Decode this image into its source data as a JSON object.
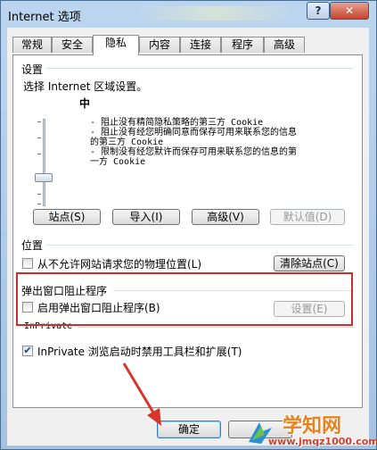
{
  "window": {
    "title": "Internet 选项",
    "help_label": "?",
    "close_label": "✕"
  },
  "tabs": [
    {
      "label": "常规"
    },
    {
      "label": "安全"
    },
    {
      "label": "隐私"
    },
    {
      "label": "内容"
    },
    {
      "label": "连接"
    },
    {
      "label": "程序"
    },
    {
      "label": "高级"
    }
  ],
  "settings": {
    "group_label": "设置",
    "zone_text": "选择 Internet 区域设置。",
    "level": "中",
    "rules": [
      "- 阻止没有精简隐私策略的第三方 Cookie",
      "- 阻止没有经您明确同意而保存可用来联系您的信息",
      "的第三方 Cookie",
      "- 限制没有经您默许而保存可用来联系您的信息的第",
      "一方 Cookie"
    ],
    "buttons": {
      "sites": "站点(S)",
      "import": "导入(I)",
      "advanced": "高级(V)",
      "default": "默认值(D)"
    }
  },
  "location": {
    "group_label": "位置",
    "checkbox_label": "从不允许网站请求您的物理位置(L)",
    "clear_button": "清除站点(C)"
  },
  "popup": {
    "group_label": "弹出窗口阻止程序",
    "checkbox_label": "启用弹出窗口阻止程序(B)",
    "settings_button": "设置(E)"
  },
  "inprivate": {
    "group_label": "InPrivate",
    "checkbox_label": "InPrivate 浏览启动时禁用工具栏和扩展(T)",
    "checked": true
  },
  "footer": {
    "ok_button": "确定"
  },
  "watermark": {
    "text": "学知网",
    "url": "www.jmqz1000.com"
  }
}
